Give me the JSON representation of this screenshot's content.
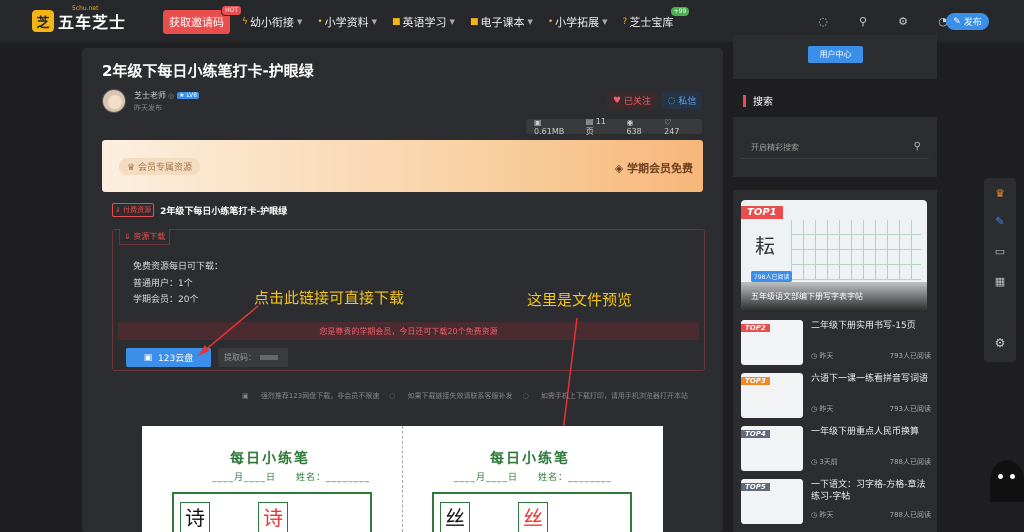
{
  "header": {
    "logo_mark": "芝",
    "logo_text": "五车芝士",
    "logo_sub": "5chu.net",
    "invite_label": "获取邀请码",
    "invite_badge": "HOT",
    "nav": [
      {
        "label": "幼小衔接"
      },
      {
        "label": "小学资料"
      },
      {
        "label": "英语学习"
      },
      {
        "label": "电子课本"
      },
      {
        "label": "小学拓展"
      },
      {
        "label": "芝士宝库",
        "badge": "+99"
      }
    ],
    "post_label": "发布"
  },
  "article": {
    "title": "2年级下每日小练笔打卡-护眼绿",
    "author": "芝士老师",
    "level": "LV8",
    "time": "昨天发布",
    "follow_label": "已关注",
    "message_label": "私信",
    "stats": {
      "size": "0.61MB",
      "pages": "11页",
      "views": "638",
      "likes": "247"
    }
  },
  "vip": {
    "left_label": "会员专属资源",
    "right_label": "学期会员免费"
  },
  "resource": {
    "tag": "付费资源",
    "title": "2年级下每日小练笔打卡-护眼绿",
    "download_label": "资源下载",
    "lines": [
      "免费资源每日可下载：",
      "普通用户：1个",
      "学期会员：20个"
    ],
    "notice": "您是尊贵的学期会员，今日还可下载20个免费资源",
    "cloud_label": "123云盘",
    "code_label": "提取码："
  },
  "annotations": {
    "link": "点击此链接可直接下载",
    "preview": "这里是文件预览"
  },
  "hints": [
    "强烈推荐123网盘下载，非会员不限速",
    "如果下载链接失效请联系客服补发",
    "如需手机上下载打印，请用手机浏览器打开本站"
  ],
  "preview": {
    "sheet_title": "每日小练笔",
    "sheet_sub": "____月____日　　姓名：________",
    "left_chars": [
      "诗",
      "诗"
    ],
    "right_chars": [
      "丝",
      "丝"
    ]
  },
  "sidebar": {
    "user_center": "用户中心",
    "search_title": "搜索",
    "search_placeholder": "开启精彩搜索",
    "top1": {
      "tag": "TOP1",
      "char": "耘",
      "reads": "798人已阅读",
      "title": "五年级语文部编下册写字表字帖"
    },
    "items": [
      {
        "tag": "TOP2",
        "title": "二年级下册实用书写-15页",
        "time": "昨天",
        "reads": "793人已阅读",
        "color": "#e94e4e"
      },
      {
        "tag": "TOP3",
        "title": "六语下一课一练看拼音写词语",
        "time": "昨天",
        "reads": "793人已阅读",
        "color": "#f08a24"
      },
      {
        "tag": "TOP4",
        "title": "一年级下册重点人民币换算",
        "time": "3天前",
        "reads": "788人已阅读",
        "color": "#5f6b7a"
      },
      {
        "tag": "TOP5",
        "title": "一下语文：习字格-方格-章法练习-字帖",
        "time": "昨天",
        "reads": "788人已阅读",
        "color": "#5f6b7a"
      }
    ]
  }
}
